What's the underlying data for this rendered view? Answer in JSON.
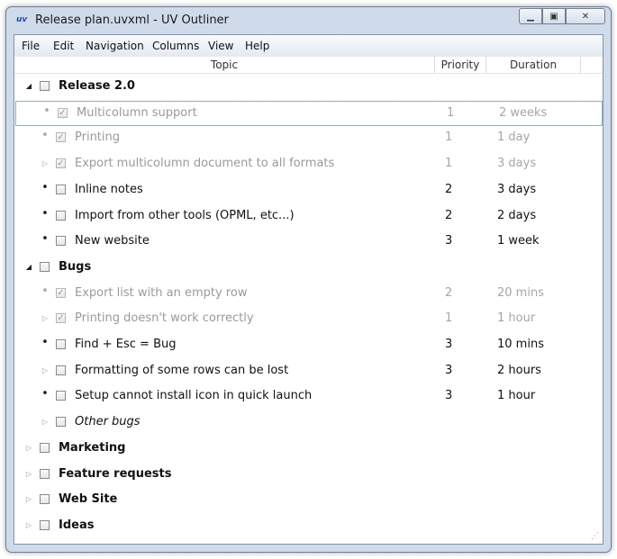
{
  "window": {
    "app_icon": "uv",
    "title": "Release plan.uvxml - UV Outliner",
    "minimize_icon": "minimize-icon",
    "maximize_icon": "maximize-icon",
    "close_icon": "close-icon"
  },
  "menu": [
    "File",
    "Edit",
    "Navigation",
    "Columns",
    "View",
    "Help"
  ],
  "columns": {
    "topic": "Topic",
    "priority": "Priority",
    "duration": "Duration"
  },
  "rows": [
    {
      "level": 0,
      "type": "group",
      "expander": "expanded",
      "topic": "Release 2.0",
      "priority": "",
      "duration": "",
      "checked": false
    },
    {
      "level": 1,
      "type": "done",
      "expander": "none",
      "topic": "Multicolumn support",
      "priority": "1",
      "duration": "2 weeks",
      "checked": true,
      "selected": true
    },
    {
      "level": 1,
      "type": "done",
      "expander": "none",
      "topic": "Printing",
      "priority": "1",
      "duration": "1 day",
      "checked": true
    },
    {
      "level": 1,
      "type": "done",
      "expander": "collapsed",
      "topic": "Export multicolumn document to all formats",
      "priority": "1",
      "duration": "3 days",
      "checked": true
    },
    {
      "level": 1,
      "type": "item",
      "expander": "none",
      "topic": "Inline notes",
      "priority": "2",
      "duration": "3 days",
      "checked": false
    },
    {
      "level": 1,
      "type": "item",
      "expander": "none",
      "topic": "Import from other tools (OPML, etc...)",
      "priority": "2",
      "duration": "2 days",
      "checked": false
    },
    {
      "level": 1,
      "type": "item",
      "expander": "none",
      "topic": "New website",
      "priority": "3",
      "duration": "1 week",
      "checked": false
    },
    {
      "level": 0,
      "type": "group",
      "expander": "expanded",
      "topic": "Bugs",
      "priority": "",
      "duration": "",
      "checked": false
    },
    {
      "level": 1,
      "type": "done",
      "expander": "none",
      "topic": "Export list with an empty row",
      "priority": "2",
      "duration": "20 mins",
      "checked": true
    },
    {
      "level": 1,
      "type": "done",
      "expander": "collapsed",
      "topic": "Printing doesn't work correctly",
      "priority": "1",
      "duration": "1 hour",
      "checked": true
    },
    {
      "level": 1,
      "type": "item",
      "expander": "none",
      "topic": "Find + Esc = Bug",
      "priority": "3",
      "duration": "10 mins",
      "checked": false
    },
    {
      "level": 1,
      "type": "item",
      "expander": "collapsed",
      "topic": "Formatting of some rows can be lost",
      "priority": "3",
      "duration": "2 hours",
      "checked": false
    },
    {
      "level": 1,
      "type": "item",
      "expander": "none",
      "topic": "Setup cannot install icon in quick launch",
      "priority": "3",
      "duration": "1 hour",
      "checked": false
    },
    {
      "level": 1,
      "type": "italic",
      "expander": "collapsed",
      "topic": "Other bugs",
      "priority": "",
      "duration": "",
      "checked": false
    },
    {
      "level": 0,
      "type": "group",
      "expander": "collapsed",
      "topic": "Marketing",
      "priority": "",
      "duration": "",
      "checked": false
    },
    {
      "level": 0,
      "type": "group",
      "expander": "collapsed",
      "topic": "Feature requests",
      "priority": "",
      "duration": "",
      "checked": false
    },
    {
      "level": 0,
      "type": "group",
      "expander": "collapsed",
      "topic": "Web Site",
      "priority": "",
      "duration": "",
      "checked": false
    },
    {
      "level": 0,
      "type": "group",
      "expander": "collapsed",
      "topic": "Ideas",
      "priority": "",
      "duration": "",
      "checked": false
    }
  ]
}
